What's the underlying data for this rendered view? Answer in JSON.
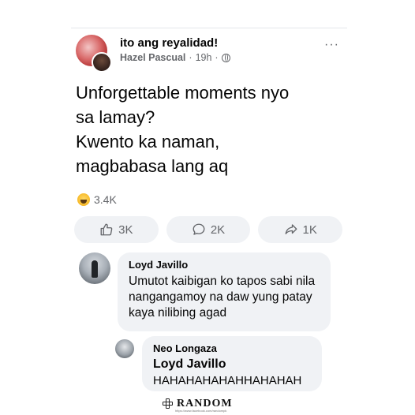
{
  "post": {
    "group_name": "ito ang reyalidad!",
    "author": "Hazel Pascual",
    "separator": "·",
    "time": "19h",
    "more": "···",
    "text_lines": [
      "Unforgettable moments nyo",
      "sa lamay?",
      "Kwento ka naman,",
      "magbabasa lang aq"
    ],
    "reaction_count": "3.4K",
    "actions": {
      "like_count": "3K",
      "comment_count": "2K",
      "share_count": "1K"
    }
  },
  "comments": [
    {
      "name": "Loyd Javillo",
      "lines": [
        "Umutot kaibigan ko tapos sabi nila",
        "nangangamoy na daw yung patay",
        "kaya nilibing agad"
      ]
    }
  ],
  "reply": {
    "name": "Neo Longaza",
    "mention": "Loyd Javillo",
    "text": "HAHAHAHAHAHHAHAHAH"
  },
  "watermark": {
    "text": "RANDOM",
    "subtext": "https://www.facebook.com/randompk"
  },
  "colors": {
    "accent": "#65676b",
    "bubble": "#f0f2f5",
    "text": "#050505"
  }
}
